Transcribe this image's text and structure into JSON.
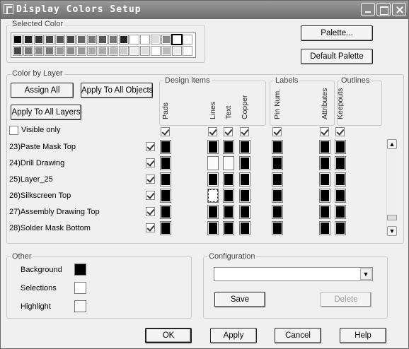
{
  "window": {
    "title": "Display Colors Setup"
  },
  "colors": {
    "titlebar": "#7a7a7a"
  },
  "selected_color": {
    "label": "Selected Color",
    "top_row": [
      "#000000",
      "#222222",
      "#333333",
      "#444444",
      "#555555",
      "#444444",
      "#666666",
      "#777777",
      "#555555",
      "#777777",
      "#222222",
      "#ffffff",
      "#ffffff",
      "#dddddd",
      "#888888",
      "#ffffff",
      "#ffffff"
    ],
    "bottom_row": [
      "#444444",
      "#777777",
      "#888888",
      "#777777",
      "#999999",
      "#888888",
      "#999999",
      "#aaaaaa",
      "#aaaaaa",
      "#bbbbbb",
      "#cccccc",
      "#eeeeee",
      "#dddddd",
      "#ffffff",
      "#bbbbbb",
      "#eeeeee",
      "#ffffff"
    ],
    "selected_index": 15
  },
  "buttons": {
    "palette": "Palette...",
    "default_palette": "Default Palette",
    "assign_all": "Assign All",
    "apply_all_objects": "Apply To All Objects",
    "apply_all_layers": "Apply To All Layers",
    "save": "Save",
    "delete": "Delete",
    "ok": "OK",
    "apply": "Apply",
    "cancel": "Cancel",
    "help": "Help"
  },
  "color_by_layer": {
    "label": "Color by Layer",
    "design_items_label": "Design items",
    "labels_label": "Labels",
    "outlines_label": "Outlines",
    "columns": [
      "Pads",
      "Lines",
      "Text",
      "Copper",
      "Pin Num.",
      "Attributes",
      "Keepouts"
    ],
    "column_checked": [
      true,
      true,
      true,
      true,
      true,
      true,
      true
    ],
    "visible_only": {
      "label": "Visible only",
      "checked": false
    },
    "layers": [
      {
        "name": "23)Paste Mask Top",
        "checked": true,
        "cells": [
          "black",
          "black",
          "black",
          "black",
          "black",
          "black",
          "black"
        ]
      },
      {
        "name": "24)Drill Drawing",
        "checked": true,
        "cells": [
          "black",
          "white",
          "white",
          "black",
          "black",
          "black",
          "black"
        ]
      },
      {
        "name": "25)Layer_25",
        "checked": true,
        "cells": [
          "black",
          "black",
          "black",
          "black",
          "black",
          "black",
          "black"
        ]
      },
      {
        "name": "26)Silkscreen Top",
        "checked": true,
        "cells": [
          "black",
          "dotted",
          "black",
          "black",
          "black",
          "black",
          "black"
        ]
      },
      {
        "name": "27)Assembly Drawing Top",
        "checked": true,
        "cells": [
          "black",
          "black",
          "black",
          "black",
          "black",
          "black",
          "black"
        ]
      },
      {
        "name": "28)Solder Mask Bottom",
        "checked": true,
        "cells": [
          "black",
          "black",
          "black",
          "black",
          "black",
          "black",
          "black"
        ]
      }
    ]
  },
  "other": {
    "label": "Other",
    "items": [
      {
        "label": "Background",
        "color": "#000000"
      },
      {
        "label": "Selections",
        "color": "#ffffff"
      },
      {
        "label": "Highlight",
        "color": "#f8f8f8"
      }
    ]
  },
  "configuration": {
    "label": "Configuration",
    "value": ""
  }
}
